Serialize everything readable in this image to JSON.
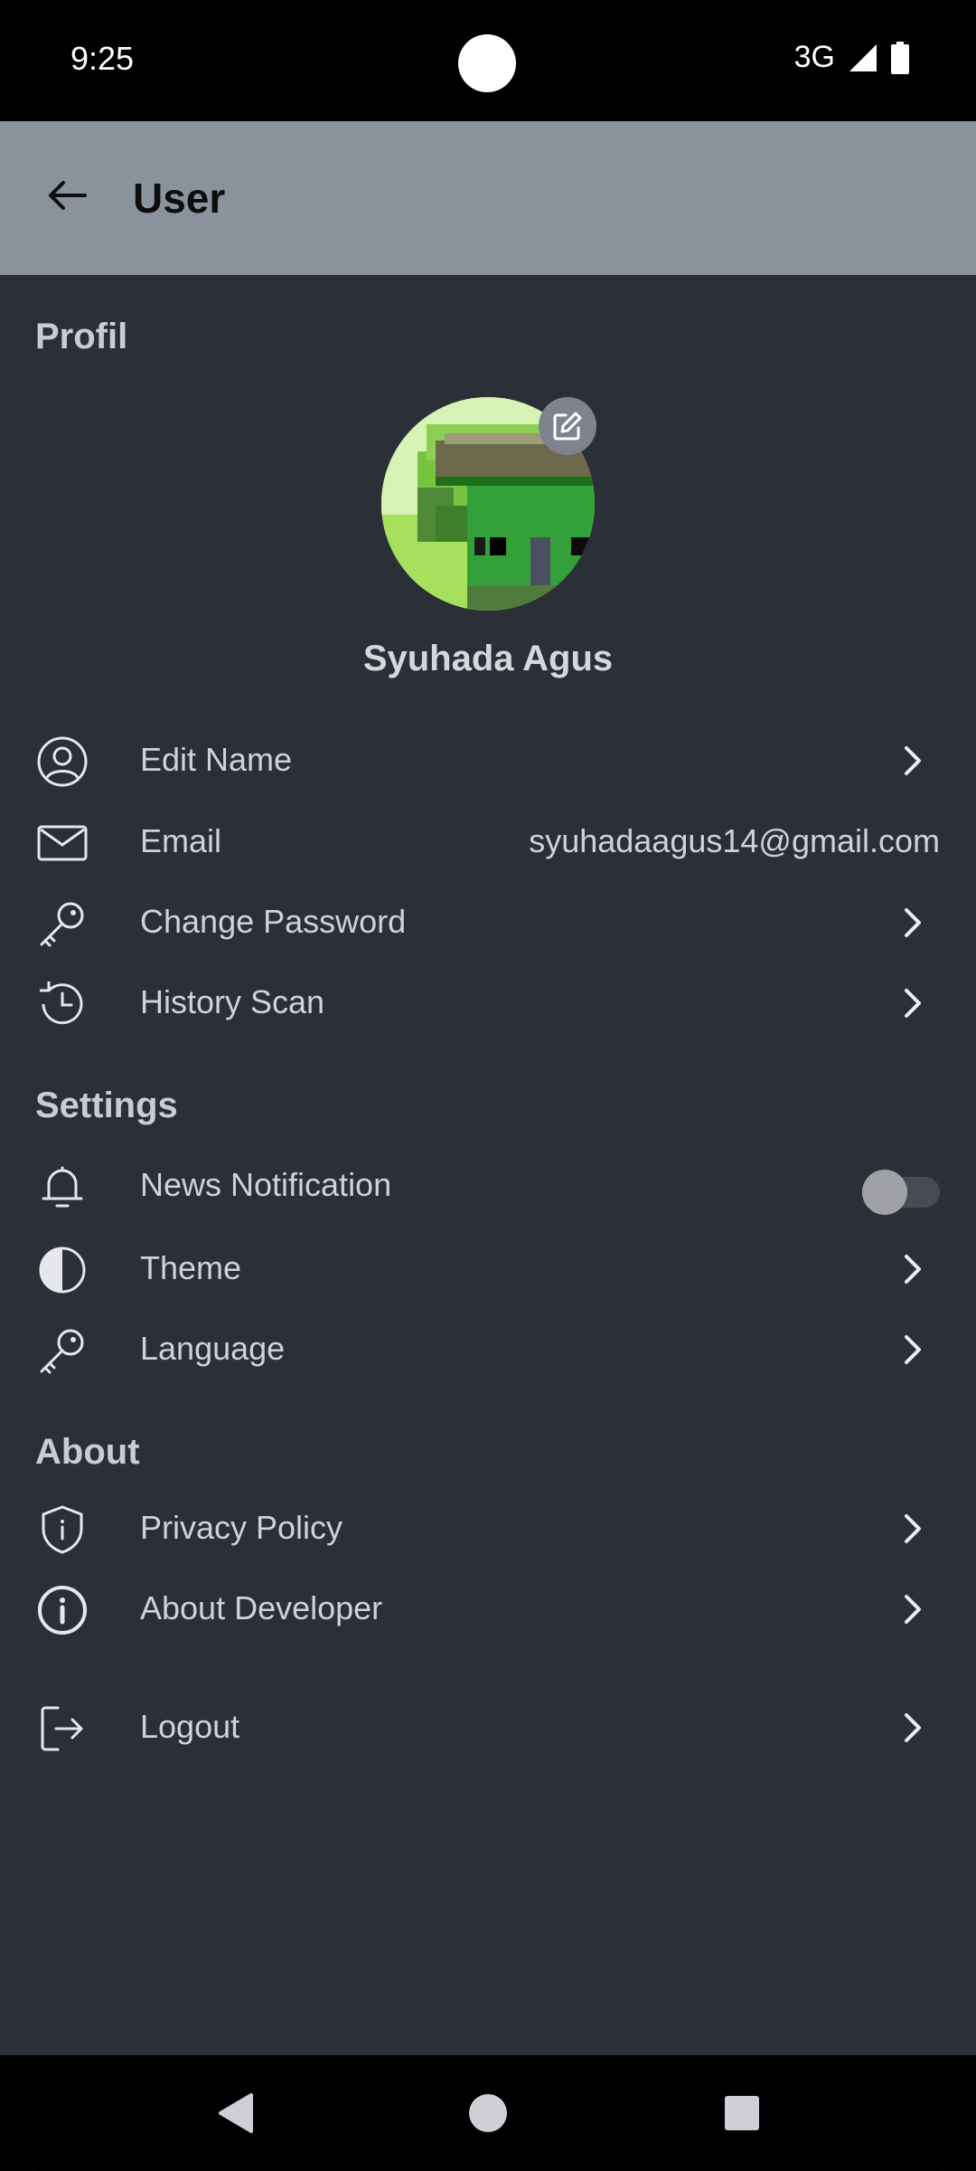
{
  "status_bar": {
    "time": "9:25",
    "network": "3G",
    "icons": [
      "signal-icon",
      "battery-icon"
    ]
  },
  "app_bar": {
    "title": "User",
    "back_icon": "arrow-left-icon"
  },
  "profile": {
    "section_title": "Profil",
    "user_name": "Syuhada Agus",
    "edit_icon": "pencil-square-icon",
    "rows": [
      {
        "label": "Edit Name",
        "icon": "user-circle-icon"
      },
      {
        "label": "Email",
        "icon": "envelope-icon",
        "value": "syuhadaagus14@gmail.com"
      },
      {
        "label": "Change Password",
        "icon": "key-icon"
      },
      {
        "label": "History Scan",
        "icon": "history-clock-icon"
      }
    ]
  },
  "settings": {
    "section_title": "Settings",
    "rows": [
      {
        "label": "News Notification",
        "icon": "bell-icon",
        "toggle_on": false
      },
      {
        "label": "Theme",
        "icon": "contrast-icon"
      },
      {
        "label": "Language",
        "icon": "key-icon"
      }
    ]
  },
  "about": {
    "section_title": "About",
    "rows": [
      {
        "label": "Privacy Policy",
        "icon": "shield-info-icon"
      },
      {
        "label": "About Developer",
        "icon": "info-circle-icon"
      },
      {
        "label": "Logout",
        "icon": "logout-icon"
      }
    ]
  },
  "nav_bar": {
    "buttons": [
      "back-triangle-icon",
      "home-circle-icon",
      "recents-square-icon"
    ]
  },
  "colors": {
    "background": "#2b2f37",
    "app_bar": "#8a939c",
    "text": "#cfd2d8"
  }
}
